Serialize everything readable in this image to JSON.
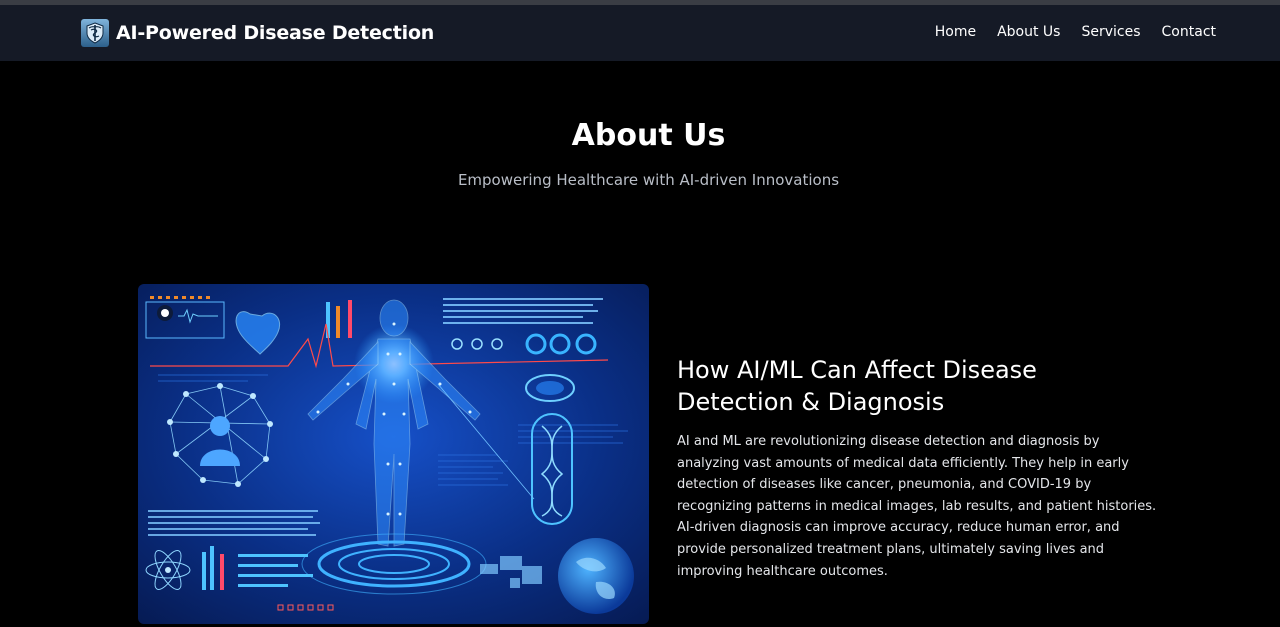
{
  "header": {
    "brand": "AI-Powered Disease Detection",
    "logo_icon": "medical-caduceus-shield-icon",
    "nav": [
      "Home",
      "About Us",
      "Services",
      "Contact"
    ]
  },
  "section": {
    "title": "About Us",
    "subtitle": "Empowering Healthcare with AI-driven Innovations"
  },
  "feature": {
    "image_icon": "ai-medical-hologram-illustration",
    "heading": "How AI/ML Can Affect Disease Detection & Diagnosis",
    "body": "AI and ML are revolutionizing disease detection and diagnosis by analyzing vast amounts of medical data efficiently. They help in early detection of diseases like cancer, pneumonia, and COVID-19 by recognizing patterns in medical images, lab results, and patient histories. AI-driven diagnosis can improve accuracy, reduce human error, and provide personalized treatment plans, ultimately saving lives and improving healthcare outcomes."
  },
  "colors": {
    "navbar_bg": "#151a26",
    "page_bg": "#000000",
    "subtitle": "#b9bec7",
    "hero_blue": "#0a3fa8"
  }
}
